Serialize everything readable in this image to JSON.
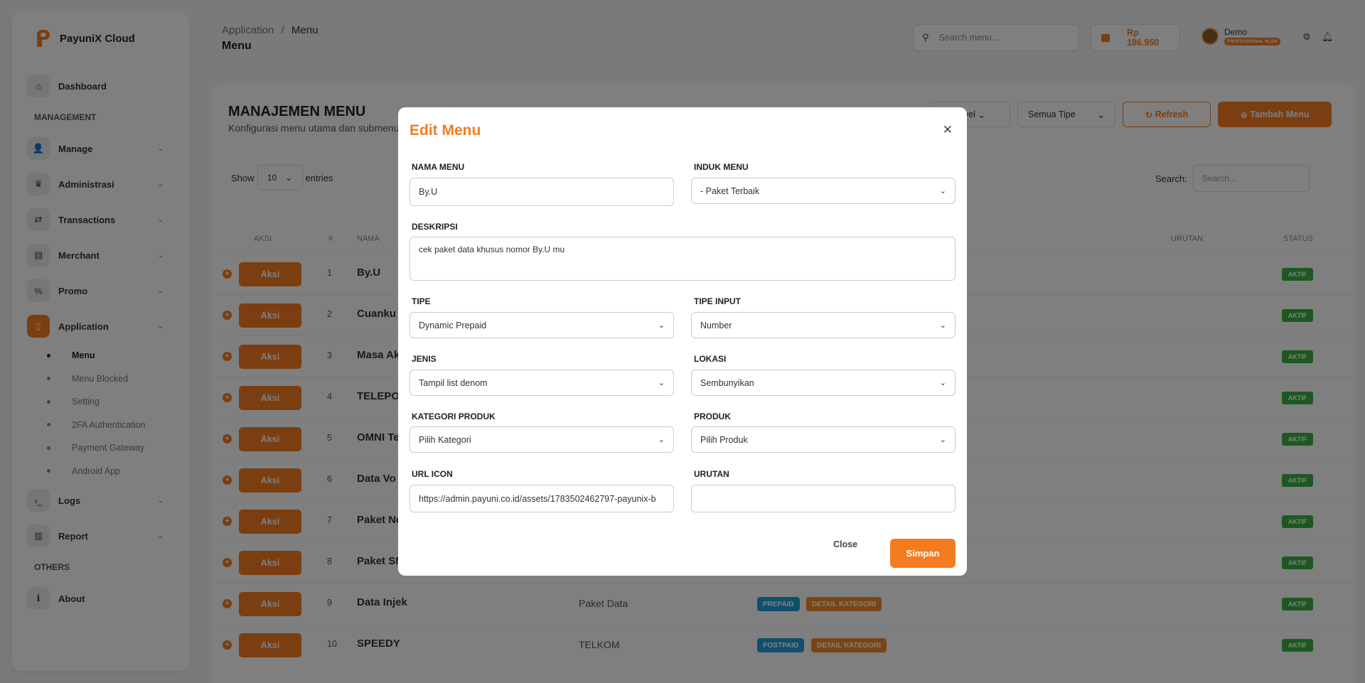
{
  "brand": {
    "name": "PayuniX Cloud"
  },
  "sidebar": {
    "dashboard": "Dashboard",
    "management_title": "MANAGEMENT",
    "manage": "Manage",
    "administrasi": "Administrasi",
    "transactions": "Transactions",
    "merchant": "Merchant",
    "promo": "Promo",
    "application": "Application",
    "sub": [
      "Menu",
      "Menu Blocked",
      "Setting",
      "2FA Authentication",
      "Payment Gateway",
      "Android App"
    ],
    "logs": "Logs",
    "report": "Report",
    "others_title": "OTHERS",
    "about": "About"
  },
  "header": {
    "breadcrumb_parent": "Application",
    "breadcrumb_sep": "/",
    "breadcrumb_current": "Menu",
    "page_title": "Menu",
    "search_placeholder": "Search menu...",
    "balance": "Rp 186.950",
    "user_name": "Demo",
    "plan": "PROFESSIONAL PLAN"
  },
  "card": {
    "title": "MANAJEMEN MENU",
    "subtitle": "Konfigurasi menu utama dan submenu",
    "level_filter": "Level",
    "type_filter": "Semua Tipe",
    "refresh": "Refresh",
    "add": "Tambah Menu",
    "show": "Show",
    "entries_value": "10",
    "entries": "entries",
    "search_label": "Search:",
    "search_placeholder": "Search..."
  },
  "table": {
    "headers": {
      "aksi": "AKSI",
      "num": "#",
      "nama": "NAMA",
      "urutan": "URUTAN",
      "status": "STATUS"
    },
    "aksi_label": "Aksi",
    "status_label": "AKTIF",
    "rows": [
      {
        "num": "1",
        "name": "By.U",
        "parent": "",
        "tags": []
      },
      {
        "num": "2",
        "name": "Cuanku",
        "parent": "",
        "tags": []
      },
      {
        "num": "3",
        "name": "Masa Ak",
        "parent": "",
        "tags": []
      },
      {
        "num": "4",
        "name": "TELEPON",
        "parent": "",
        "tags": []
      },
      {
        "num": "5",
        "name": "OMNI Te",
        "parent": "",
        "tags": []
      },
      {
        "num": "6",
        "name": "Data Vo",
        "parent": "",
        "tags": []
      },
      {
        "num": "7",
        "name": "Paket Ne",
        "parent": "",
        "tags": []
      },
      {
        "num": "8",
        "name": "Paket SM",
        "parent": "",
        "tags": []
      },
      {
        "num": "9",
        "name": "Data Injek",
        "parent": "Paket Data",
        "tags": [
          {
            "label": "PREPAID",
            "color": "#1e9fd6"
          },
          {
            "label": "DETAIL KATEGORI",
            "color": "#f58b2b"
          }
        ]
      },
      {
        "num": "10",
        "name": "SPEEDY",
        "parent": "TELKOM",
        "tags": [
          {
            "label": "POSTPAID",
            "color": "#1e9fd6"
          },
          {
            "label": "DETAIL KATEGORI",
            "color": "#f58b2b"
          }
        ]
      }
    ]
  },
  "modal": {
    "title": "Edit Menu",
    "nama_menu_label": "NAMA MENU",
    "nama_menu_value": "By.U",
    "induk_menu_label": "INDUK MENU",
    "induk_menu_value": "- Paket Terbaik",
    "deskripsi_label": "DESKRIPSI",
    "deskripsi_value": "cek paket data khusus nomor By.U mu",
    "tipe_label": "TIPE",
    "tipe_value": "Dynamic Prepaid",
    "tipe_input_label": "TIPE INPUT",
    "tipe_input_value": "Number",
    "jenis_label": "JENIS",
    "jenis_value": "Tampil list denom",
    "lokasi_label": "LOKASI",
    "lokasi_value": "Sembunyikan",
    "kategori_label": "KATEGORI PRODUK",
    "kategori_value": "Pilih Kategori",
    "produk_label": "PRODUK",
    "produk_value": "Pilih Produk",
    "url_icon_label": "URL ICON",
    "url_icon_value": "https://admin.payuni.co.id/assets/1783502462797-payunix-b",
    "urutan_label": "URUTAN",
    "urutan_value": "",
    "close": "Close",
    "save": "Simpan"
  },
  "colors": {
    "accent": "#f47c20",
    "status": "#3cb043",
    "prepaid": "#1e9fd6",
    "overlay": "rgba(0,0,0,0.5)"
  }
}
